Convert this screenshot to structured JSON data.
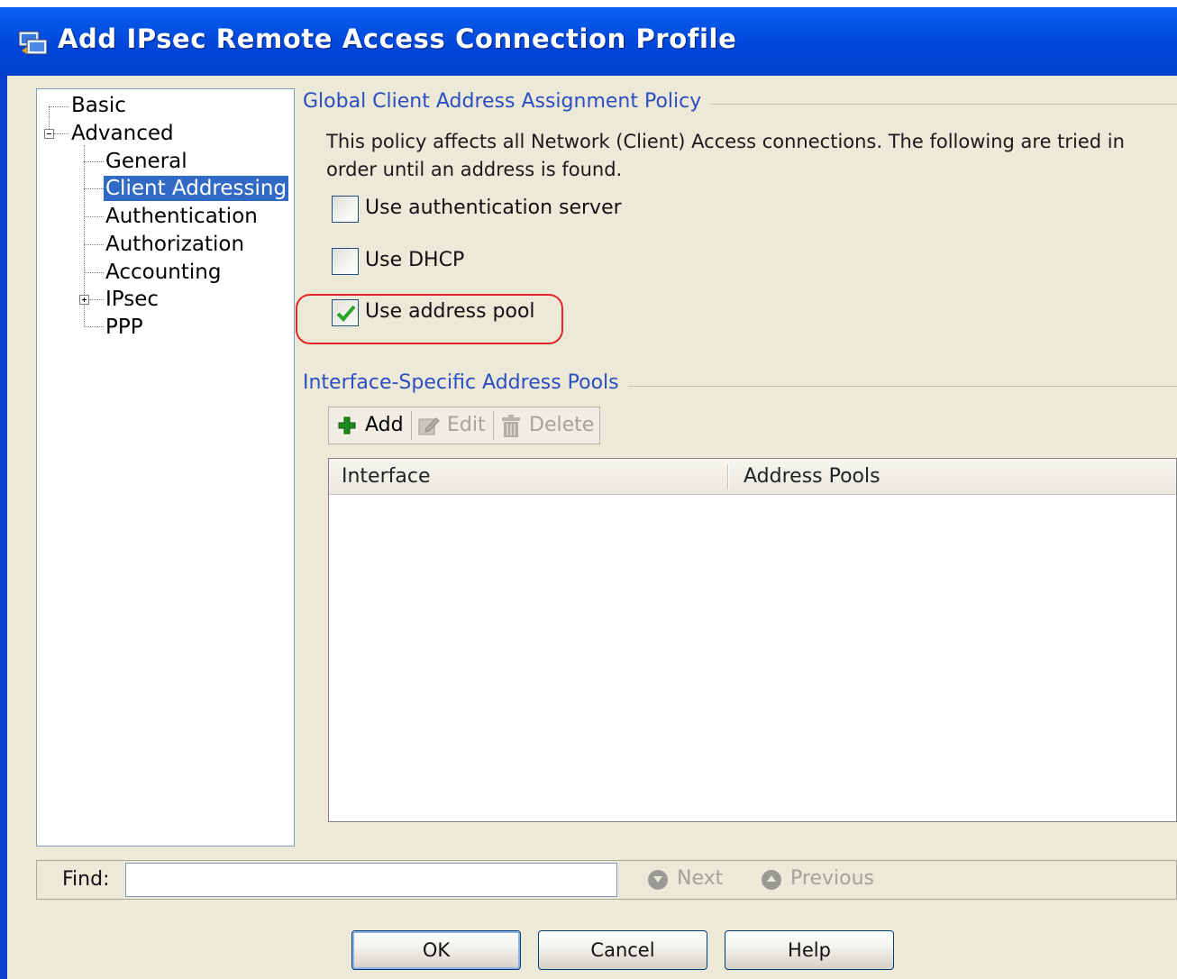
{
  "window": {
    "title": "Add IPsec Remote Access Connection Profile"
  },
  "tree": {
    "items": [
      {
        "label": "Basic"
      },
      {
        "label": "Advanced"
      },
      {
        "label": "General"
      },
      {
        "label": "Client Addressing",
        "selected": true
      },
      {
        "label": "Authentication"
      },
      {
        "label": "Authorization"
      },
      {
        "label": "Accounting"
      },
      {
        "label": "IPsec"
      },
      {
        "label": "PPP"
      }
    ]
  },
  "policy": {
    "group_title": "Global Client Address Assignment Policy",
    "description": "This policy affects all Network (Client) Access connections. The following are tried in order until an address is found.",
    "options": [
      {
        "label": "Use authentication server",
        "checked": false
      },
      {
        "label": "Use DHCP",
        "checked": false
      },
      {
        "label": "Use address pool",
        "checked": true
      }
    ]
  },
  "pools": {
    "group_title": "Interface-Specific Address Pools",
    "toolbar": {
      "add_label": "Add",
      "edit_label": "Edit",
      "delete_label": "Delete"
    },
    "columns": [
      "Interface",
      "Address Pools"
    ],
    "rows": []
  },
  "find": {
    "label": "Find:",
    "value": "",
    "next_label": "Next",
    "previous_label": "Previous"
  },
  "buttons": {
    "ok": "OK",
    "cancel": "Cancel",
    "help": "Help"
  },
  "colors": {
    "titlebar": "#0046d8",
    "selection": "#316ac5",
    "group_title": "#2b4ec0",
    "highlight": "#e3262b",
    "checkmark": "#2aa52a"
  }
}
